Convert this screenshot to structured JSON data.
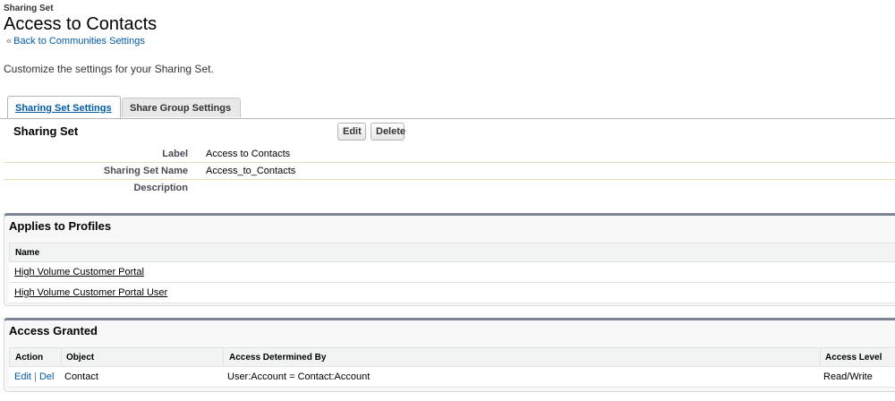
{
  "header": {
    "eyebrow": "Sharing Set",
    "title": "Access to Contacts",
    "back_chevron": "«",
    "back_link": "Back to Communities Settings",
    "intro": "Customize the settings for your Sharing Set."
  },
  "tabs": [
    {
      "label": "Sharing Set Settings",
      "active": true
    },
    {
      "label": "Share Group Settings",
      "active": false
    }
  ],
  "detail": {
    "title": "Sharing Set",
    "edit_label": "Edit",
    "delete_label": "Delete",
    "fields": [
      {
        "label": "Label",
        "value": "Access to Contacts"
      },
      {
        "label": "Sharing Set Name",
        "value": "Access_to_Contacts"
      },
      {
        "label": "Description",
        "value": ""
      }
    ]
  },
  "profiles": {
    "title": "Applies to Profiles",
    "header": "Name",
    "rows": [
      "High Volume Customer Portal",
      "High Volume Customer Portal User"
    ]
  },
  "access": {
    "title": "Access Granted",
    "headers": [
      "Action",
      "Object",
      "Access Determined By",
      "Access Level"
    ],
    "rows": [
      {
        "edit": "Edit",
        "sep": "|",
        "del": "Del",
        "object": "Contact",
        "determined_by": "User:Account = Contact:Account",
        "level": "Read/Write"
      }
    ]
  },
  "colors": {
    "link": "#015ba7",
    "section_border": "#7b8596"
  }
}
